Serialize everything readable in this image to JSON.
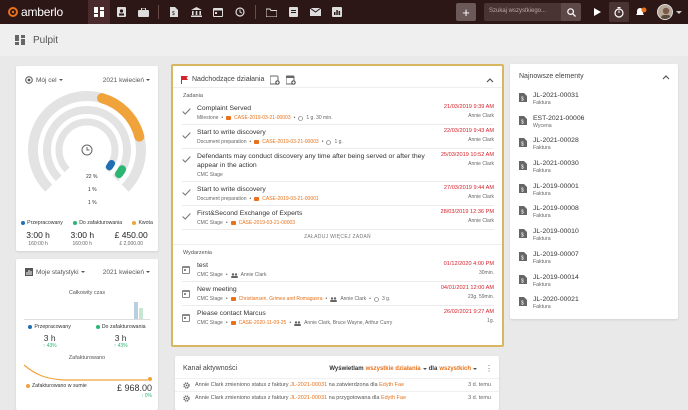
{
  "app": {
    "logo": "amberlo"
  },
  "search": {
    "placeholder": "Szukaj wszystkiego..."
  },
  "page": {
    "title": "Pulpit"
  },
  "colors": {
    "brand": "#e8711a",
    "topbar": "#2d1616",
    "highlight": "#d9b762",
    "due": "#d6222a",
    "processed": "#1f6fb2",
    "unbilled": "#2bb673",
    "quota": "#f0a33a"
  },
  "goal": {
    "title": "Mój cel",
    "period": "2021 kwiecień",
    "center_pct": "22 %",
    "ring2_pct": "1 %",
    "ring3_pct": "1 %",
    "ring_fill": [
      0.22,
      0.01,
      0.01
    ],
    "legend": [
      {
        "label": "Przepracowany",
        "value": "3:00 h",
        "sub": "160:00 h"
      },
      {
        "label": "Do zafakturowania",
        "value": "3:00 h",
        "sub": "160:00 h"
      },
      {
        "label": "Kwota",
        "value": "£ 450.00",
        "sub": "£ 2,000.00"
      }
    ]
  },
  "stats": {
    "title": "Moje statystyki",
    "period": "2021 kwiecień",
    "total_label": "Całkowity czas",
    "processed_label": "Przepracowany",
    "processed_value": "3 h",
    "processed_change": "↑ 43%",
    "unbilled_label": "Do zafakturowania",
    "unbilled_value": "3 h",
    "unbilled_change": "↑ 43%",
    "invoiced_label": "Zafakturowano",
    "amount_label": "Zafakturowano w sumie",
    "amount_value": "£ 968.00",
    "amount_change": "↑ 0%"
  },
  "upcoming": {
    "title": "Nadchodzące działania",
    "tasks_label": "Zadania",
    "events_label": "Wydarzenia",
    "load_more": "ZAŁADUJ WIĘCEJ ZADAŃ",
    "tasks": [
      {
        "title": "Complaint Served",
        "type": "Milestone",
        "case": "CASE-2019-03-21-00003",
        "extra": "1 g. 30 min.",
        "date": "21/03/2019 9:39 AM",
        "who": "Annie Clark"
      },
      {
        "title": "Start to write discovery",
        "type": "Document preparation",
        "case": "CASE-2019-03-21-00003",
        "extra": "1 g.",
        "date": "22/03/2019 9:43 AM",
        "who": "Annie Clark"
      },
      {
        "title": "Defendants may conduct discovery any time after being served or after they appear in the action",
        "type": "CMC Stage",
        "case": "",
        "extra": "",
        "date": "25/03/2019 10:52 AM",
        "who": "Annie Clark"
      },
      {
        "title": "Start to write discovery",
        "type": "Document preparation",
        "case": "CASE-2019-03-21-00001",
        "extra": "",
        "date": "27/03/2019 9:44 AM",
        "who": "Annie Clark"
      },
      {
        "title": "First&Second Exchange of Experts",
        "type": "CMC Stage",
        "case": "CASE-2019-03-21-00003",
        "extra": "",
        "date": "28/03/2019 12:36 PM",
        "who": "Annie Clark"
      }
    ],
    "events": [
      {
        "title": "test",
        "type": "CMC Stage",
        "case": "",
        "people": "Annie Clark",
        "date": "01/12/2020 4:00 PM",
        "dur": "30min."
      },
      {
        "title": "New meeting",
        "type": "CMC Stage",
        "case": "Christiansen, Grimes and Romaguera",
        "people": "Annie Clark",
        "extra": "3 g.",
        "date": "04/01/2021 12:00 AM",
        "dur": "23g. 59min."
      },
      {
        "title": "Please contact Marcus",
        "type": "CMC Stage",
        "case": "CASE-2020-11-09-25",
        "people": "Annie Clark, Bruce Wayne, Arthur Curry",
        "date": "26/02/2021 9:27 AM",
        "dur": "1g."
      }
    ]
  },
  "newest": {
    "title": "Najnowsze elementy",
    "items": [
      {
        "id": "JL-2021-00031",
        "type": "Faktura"
      },
      {
        "id": "EST-2021-00006",
        "type": "Wycena"
      },
      {
        "id": "JL-2021-00028",
        "type": "Faktura"
      },
      {
        "id": "JL-2021-00030",
        "type": "Faktura"
      },
      {
        "id": "JL-2019-00001",
        "type": "Faktura"
      },
      {
        "id": "JL-2019-00008",
        "type": "Faktura"
      },
      {
        "id": "JL-2019-00010",
        "type": "Faktura"
      },
      {
        "id": "JL-2019-00007",
        "type": "Faktura"
      },
      {
        "id": "JL-2019-00014",
        "type": "Faktura"
      },
      {
        "id": "JL-2020-00021",
        "type": "Faktura"
      }
    ]
  },
  "feed": {
    "title": "Kanał aktywności",
    "filter_prefix": "Wyświetlam",
    "filter_value": "wszystkie działania",
    "filter_mid": "dla",
    "filter_who": "wszystkich",
    "rows": [
      {
        "who": "Annie Clark",
        "text": "zmieniono status z faktury",
        "ref": "JL-2021-00031",
        "text2": "na zatwierdzona dla",
        "to": "Edyth Fae",
        "ago": "3 d. temu"
      },
      {
        "who": "Annie Clark",
        "text": "zmieniono status z faktury",
        "ref": "JL-2021-00031",
        "text2": "na przygotowana dla",
        "to": "Edyth Fae",
        "ago": "3 d. temu"
      }
    ]
  }
}
